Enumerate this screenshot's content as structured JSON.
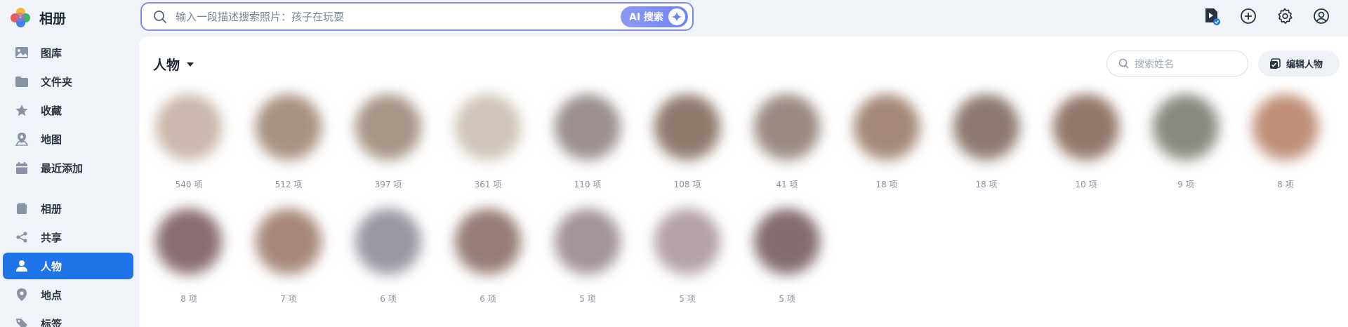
{
  "app": {
    "title": "相册"
  },
  "sidebar": {
    "items": [
      {
        "label": "图库",
        "icon": "image-icon"
      },
      {
        "label": "文件夹",
        "icon": "folder-icon"
      },
      {
        "label": "收藏",
        "icon": "star-icon"
      },
      {
        "label": "地图",
        "icon": "map-pin-icon"
      },
      {
        "label": "最近添加",
        "icon": "calendar-icon"
      },
      {
        "label": "相册",
        "icon": "album-icon"
      },
      {
        "label": "共享",
        "icon": "share-icon"
      },
      {
        "label": "人物",
        "icon": "person-icon",
        "active": true
      },
      {
        "label": "地点",
        "icon": "location-icon"
      },
      {
        "label": "标签",
        "icon": "tag-icon"
      }
    ]
  },
  "search": {
    "placeholder": "输入一段描述搜索照片：孩子在玩耍",
    "ai_label": "AI 搜索"
  },
  "main": {
    "title": "人物",
    "name_search_placeholder": "搜索姓名",
    "edit_label": "编辑人物"
  },
  "people": [
    {
      "count": "540 项",
      "color": "#c9b8ab"
    },
    {
      "count": "512 项",
      "color": "#a89182"
    },
    {
      "count": "397 项",
      "color": "#a69687"
    },
    {
      "count": "361 项",
      "color": "#cfc5b8"
    },
    {
      "count": "110 项",
      "color": "#9b8f8f"
    },
    {
      "count": "108 项",
      "color": "#8e7a6d"
    },
    {
      "count": "41 项",
      "color": "#9a8a82"
    },
    {
      "count": "18 项",
      "color": "#a58878"
    },
    {
      "count": "18 项",
      "color": "#8c7a70"
    },
    {
      "count": "10 项",
      "color": "#94776b"
    },
    {
      "count": "9 项",
      "color": "#8a8a82"
    },
    {
      "count": "8 项",
      "color": "#c09078"
    },
    {
      "count": "8 项",
      "color": "#8a6d70"
    },
    {
      "count": "7 项",
      "color": "#a8877a"
    },
    {
      "count": "6 项",
      "color": "#9a98a2"
    },
    {
      "count": "6 项",
      "color": "#967c74"
    },
    {
      "count": "5 项",
      "color": "#a2949a"
    },
    {
      "count": "5 项",
      "color": "#b3a2a8"
    },
    {
      "count": "5 项",
      "color": "#826c70"
    }
  ]
}
